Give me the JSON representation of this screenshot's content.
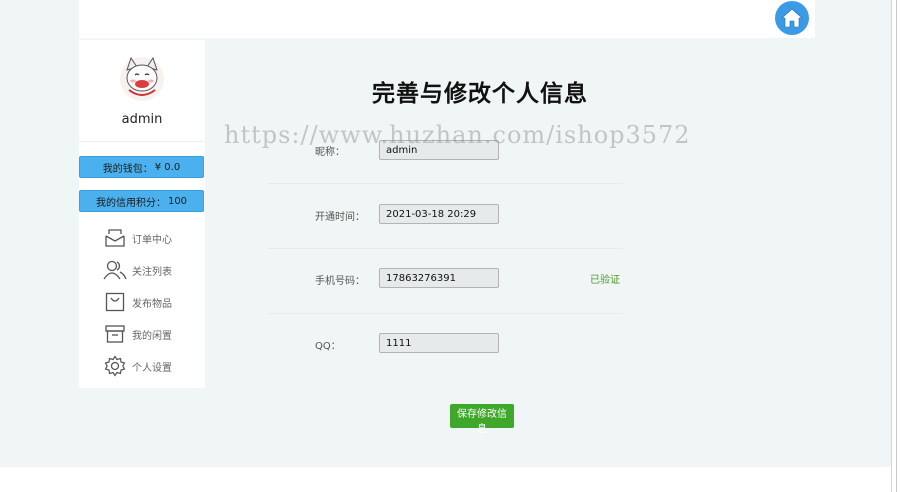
{
  "header": {
    "home_icon": "home-icon"
  },
  "sidebar": {
    "username": "admin",
    "wallet": {
      "label": "我的钱包：",
      "value": "¥ 0.0"
    },
    "credit": {
      "label": "我的信用积分：",
      "value": "100"
    },
    "nav": [
      {
        "label": "订单中心",
        "icon": "inbox-icon"
      },
      {
        "label": "关注列表",
        "icon": "users-icon"
      },
      {
        "label": "发布物品",
        "icon": "shopping-bag-icon"
      },
      {
        "label": "我的闲置",
        "icon": "archive-box-icon"
      },
      {
        "label": "个人设置",
        "icon": "gear-icon"
      }
    ]
  },
  "main": {
    "title": "完善与修改个人信息",
    "fields": {
      "nickname": {
        "label": "昵称：",
        "value": "admin"
      },
      "open_time": {
        "label": "开通时间：",
        "value": "2021-03-18 20:29"
      },
      "phone": {
        "label": "手机号码：",
        "value": "17863276391",
        "status": "已验证"
      },
      "qq": {
        "label": "QQ：",
        "value": "1111"
      }
    },
    "save_label": "保存修改信息"
  },
  "watermark": "https://www.huzhan.com/ishop3572",
  "colors": {
    "accent_blue": "#4ab1ee",
    "save_green": "#3fa82a",
    "verified_green": "#4a9a2a",
    "home_blue": "#3a9ae6"
  }
}
